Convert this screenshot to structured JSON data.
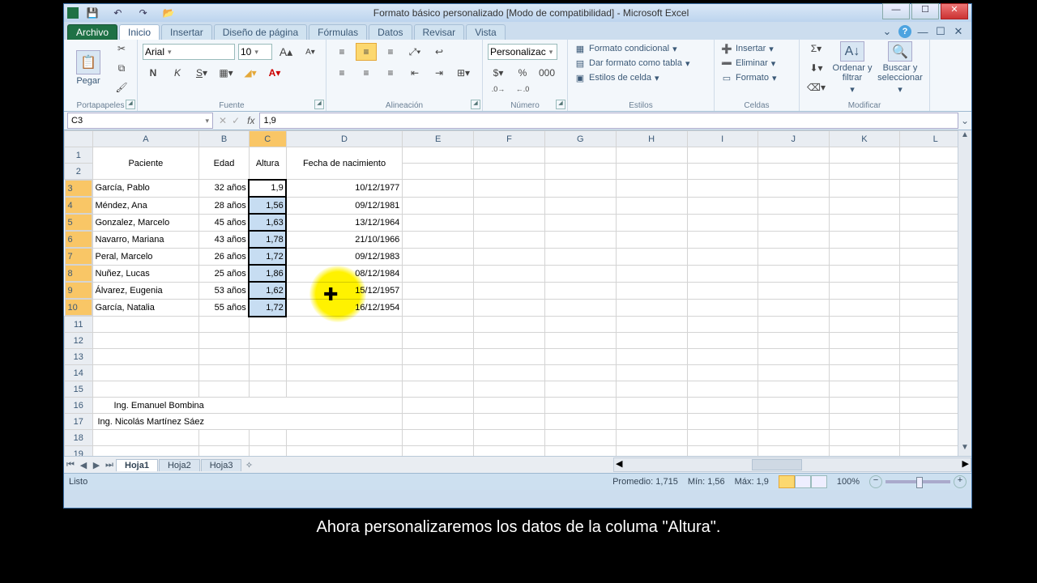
{
  "window": {
    "title": "Formato básico personalizado  [Modo de compatibilidad] - Microsoft Excel"
  },
  "tabs": {
    "file": "Archivo",
    "home": "Inicio",
    "insert": "Insertar",
    "layout": "Diseño de página",
    "formulas": "Fórmulas",
    "data": "Datos",
    "review": "Revisar",
    "view": "Vista"
  },
  "ribbon": {
    "clipboard": {
      "label": "Portapapeles",
      "paste": "Pegar"
    },
    "font": {
      "label": "Fuente",
      "name": "Arial",
      "size": "10"
    },
    "align": {
      "label": "Alineación"
    },
    "number": {
      "label": "Número",
      "fmt": "Personalizac"
    },
    "styles": {
      "label": "Estilos",
      "cond": "Formato condicional",
      "table": "Dar formato como tabla",
      "cell": "Estilos de celda"
    },
    "cells": {
      "label": "Celdas",
      "ins": "Insertar",
      "del": "Eliminar",
      "fmt": "Formato"
    },
    "editing": {
      "label": "Modificar",
      "sort": "Ordenar y filtrar",
      "find": "Buscar y seleccionar"
    }
  },
  "fx": {
    "ref": "C3",
    "val": "1,9"
  },
  "cols": [
    "A",
    "B",
    "C",
    "D",
    "E",
    "F",
    "G",
    "H",
    "I",
    "J",
    "K",
    "L"
  ],
  "headers": {
    "A": "Paciente",
    "B": "Edad",
    "C": "Altura",
    "D": "Fecha de nacimiento"
  },
  "rows": [
    {
      "n": 3,
      "A": "García, Pablo",
      "B": "32 años",
      "C": "1,9",
      "D": "10/12/1977"
    },
    {
      "n": 4,
      "A": "Méndez, Ana",
      "B": "28 años",
      "C": "1,56",
      "D": "09/12/1981"
    },
    {
      "n": 5,
      "A": "Gonzalez, Marcelo",
      "B": "45 años",
      "C": "1,63",
      "D": "13/12/1964"
    },
    {
      "n": 6,
      "A": "Navarro, Mariana",
      "B": "43 años",
      "C": "1,78",
      "D": "21/10/1966"
    },
    {
      "n": 7,
      "A": "Peral, Marcelo",
      "B": "26 años",
      "C": "1,72",
      "D": "09/12/1983"
    },
    {
      "n": 8,
      "A": "Nuñez, Lucas",
      "B": "25 años",
      "C": "1,86",
      "D": "08/12/1984"
    },
    {
      "n": 9,
      "A": "Álvarez, Eugenia",
      "B": "53 años",
      "C": "1,62",
      "D": "15/12/1957"
    },
    {
      "n": 10,
      "A": "García, Natalia",
      "B": "55 años",
      "C": "1,72",
      "D": "16/12/1954"
    }
  ],
  "credits": {
    "a": "Ing. Emanuel Bombina",
    "b": "Ing. Nicolás Martínez Sáez"
  },
  "sheets": {
    "s1": "Hoja1",
    "s2": "Hoja2",
    "s3": "Hoja3"
  },
  "status": {
    "ready": "Listo",
    "avg": "Promedio: 1,715",
    "min": "Mín: 1,56",
    "max": "Máx: 1,9",
    "zoom": "100%"
  },
  "subtitle": "Ahora personalizaremos los datos de la columa \"Altura\"."
}
